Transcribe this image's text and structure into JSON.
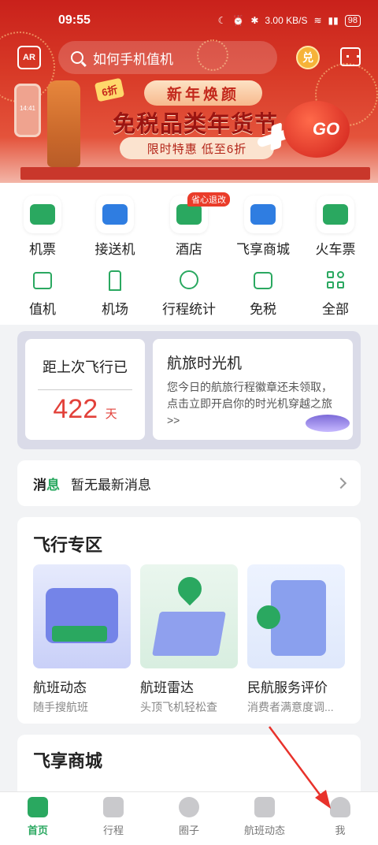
{
  "status": {
    "time": "09:55",
    "speed": "3.00 KB/S",
    "battery": "98"
  },
  "header": {
    "ar_label": "AR",
    "search_placeholder": "如何手机值机",
    "coin_label": "兑"
  },
  "banner": {
    "tag": "6折",
    "pill": "新年焕颜",
    "title": "免税品类年货节",
    "subtitle": "限时特惠 低至6折",
    "phone_time": "14:41",
    "lantern": "GO"
  },
  "services_row1": [
    {
      "label": "机票",
      "color": "#2aa860"
    },
    {
      "label": "接送机",
      "color": "#2f7de1"
    },
    {
      "label": "酒店",
      "color": "#2aa860",
      "badge": "省心退改"
    },
    {
      "label": "飞享商城",
      "color": "#2f7de1"
    },
    {
      "label": "火车票",
      "color": "#2aa860"
    }
  ],
  "services_row2": [
    {
      "label": "值机"
    },
    {
      "label": "机场"
    },
    {
      "label": "行程统计"
    },
    {
      "label": "免税"
    },
    {
      "label": "全部"
    }
  ],
  "time_machine": {
    "since_label": "距上次飞行已",
    "days": "422",
    "days_unit": "天",
    "title": "航旅时光机",
    "desc": "您今日的航旅行程徽章还未领取，点击立即开启你的时光机穿越之旅 >>"
  },
  "message": {
    "kw1": "消",
    "kw2": "息",
    "text": "暂无最新消息"
  },
  "flight_zone": {
    "title": "飞行专区",
    "cards": [
      {
        "title": "航班动态",
        "subtitle": "随手搜航班"
      },
      {
        "title": "航班雷达",
        "subtitle": "头顶飞机轻松查"
      },
      {
        "title": "民航服务评价",
        "subtitle": "消费者满意度调..."
      }
    ]
  },
  "mall": {
    "title": "飞享商城"
  },
  "tabs": [
    {
      "label": "首页",
      "active": true
    },
    {
      "label": "行程",
      "active": false
    },
    {
      "label": "圈子",
      "active": false
    },
    {
      "label": "航班动态",
      "active": false
    },
    {
      "label": "我",
      "active": false
    }
  ],
  "colors": {
    "brand": "#2aa860",
    "accent_red": "#e2413a",
    "annotation_arrow": "#e8322b"
  }
}
